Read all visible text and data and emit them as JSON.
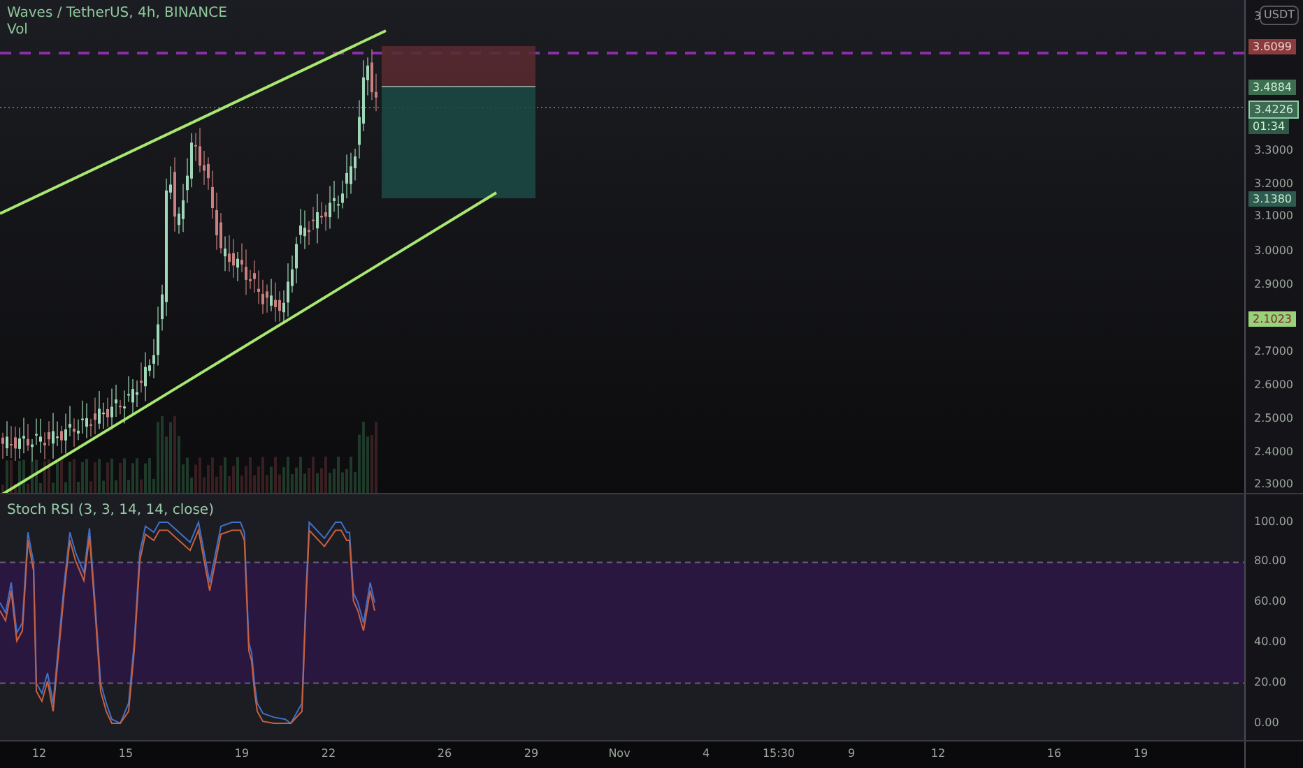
{
  "legend": {
    "title": "Waves / TetherUS, 4h, BINANCE",
    "volume": "Vol"
  },
  "price_axis": {
    "currency": "USDT",
    "ticks": [
      "3",
      "3.3000",
      "3.2000",
      "3.1000",
      "3.0000",
      "2.9000",
      "2.7000",
      "2.6000",
      "2.5000",
      "2.4000",
      "2.3000"
    ],
    "badges": [
      {
        "text": "3.6099",
        "kind": "loss"
      },
      {
        "text": "3.4884",
        "kind": "entry"
      },
      {
        "text": "3.4226",
        "kind": "last"
      },
      {
        "text": "01:34",
        "kind": "countdown"
      },
      {
        "text": "3.1380",
        "kind": "target"
      },
      {
        "text": "2.1023",
        "kind": "alert"
      }
    ]
  },
  "oscillator": {
    "label": "Stoch RSI (3, 3, 14, 14, close)",
    "ticks": [
      "100.00",
      "80.00",
      "60.00",
      "40.00",
      "20.00",
      "0.00"
    ]
  },
  "time_axis": {
    "labels": [
      "12",
      "15",
      "19",
      "22",
      "26",
      "29",
      "Nov",
      "4",
      "15:30",
      "9",
      "12",
      "16",
      "19"
    ]
  }
}
